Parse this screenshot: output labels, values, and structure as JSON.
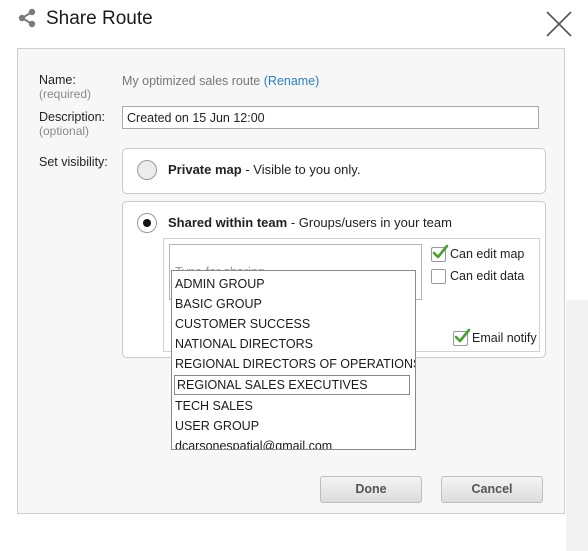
{
  "dialog": {
    "title": "Share Route"
  },
  "form": {
    "name_label": "Name:",
    "name_required": "(required)",
    "route_name": "My optimized sales route",
    "rename_link": "(Rename)",
    "description_label": "Description:",
    "description_optional": "(optional)",
    "description_value": "Created on 15 Jun 12:00",
    "visibility_label": "Set visibility:"
  },
  "visibility": {
    "private": {
      "title": "Private map",
      "desc": " - Visible to you only.",
      "selected": false
    },
    "team": {
      "title": "Shared within team",
      "desc": " - Groups/users in your team",
      "selected": true
    }
  },
  "sharing": {
    "input_placeholder": "Type for sharing",
    "input_value": "",
    "can_edit_map": {
      "label": "Can edit map",
      "checked": true
    },
    "can_edit_data": {
      "label": "Can edit data",
      "checked": false
    },
    "email_notify": {
      "label": "Email notify",
      "checked": true
    }
  },
  "dropdown": {
    "items": [
      "ADMIN GROUP",
      "BASIC GROUP",
      "CUSTOMER SUCCESS",
      "NATIONAL DIRECTORS",
      "REGIONAL DIRECTORS OF OPERATIONS",
      "REGIONAL SALES EXECUTIVES",
      "TECH SALES",
      "USER GROUP",
      "dcarsonespatial@gmail.com"
    ],
    "highlighted": "REGIONAL SALES EXECUTIVES"
  },
  "buttons": {
    "done": "Done",
    "cancel": "Cancel"
  },
  "colors": {
    "link": "#2a7fc1",
    "check": "#4aa02c"
  }
}
